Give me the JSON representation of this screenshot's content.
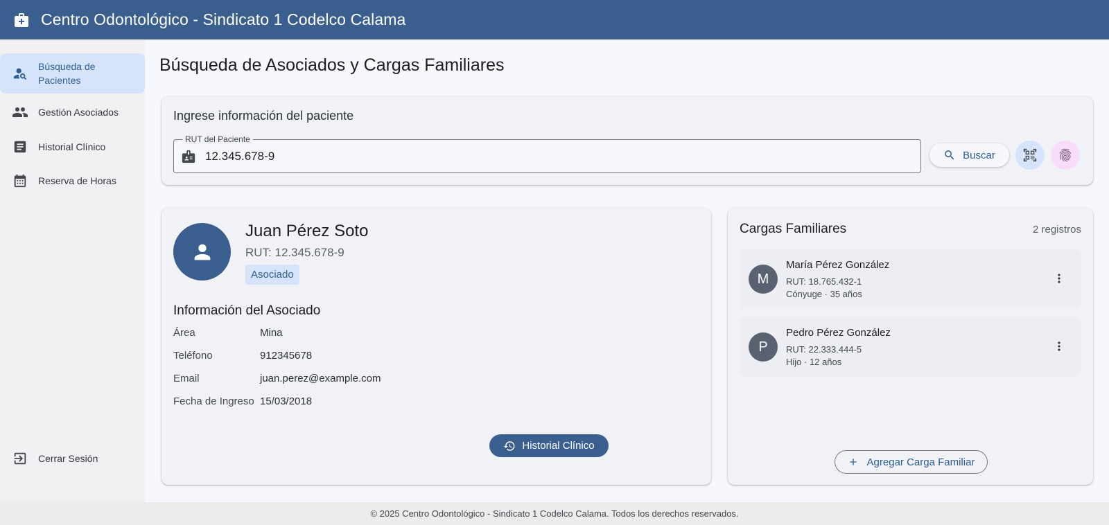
{
  "app": {
    "title": "Centro Odontológico - Sindicato 1 Codelco Calama",
    "logo_icon": "medical-kit-icon"
  },
  "sidebar": {
    "items": [
      {
        "label": "Búsqueda de Pacientes",
        "icon": "person-search-icon",
        "active": true
      },
      {
        "label": "Gestión Asociados",
        "icon": "group-icon",
        "active": false
      },
      {
        "label": "Historial Clínico",
        "icon": "document-icon",
        "active": false
      },
      {
        "label": "Reserva de Horas",
        "icon": "calendar-icon",
        "active": false
      }
    ],
    "logout_label": "Cerrar Sesión"
  },
  "main": {
    "title": "Búsqueda de Asociados y Cargas Familiares"
  },
  "search": {
    "heading": "Ingrese información del paciente",
    "field_label": "RUT del Paciente",
    "field_value": "12.345.678-9",
    "button_label": "Buscar"
  },
  "patient": {
    "name": "Juan Pérez Soto",
    "rut": "RUT: 12.345.678-9",
    "badge": "Asociado",
    "section_title": "Información del Asociado",
    "info": [
      {
        "key": "Área",
        "value": "Mina"
      },
      {
        "key": "Teléfono",
        "value": "912345678"
      },
      {
        "key": "Email",
        "value": "juan.perez@example.com"
      },
      {
        "key": "Fecha de Ingreso",
        "value": "15/03/2018"
      }
    ],
    "history_button": "Historial Clínico"
  },
  "family": {
    "title": "Cargas Familiares",
    "count": "2 registros",
    "members": [
      {
        "initial": "M",
        "name": "María Pérez González",
        "rut": "RUT: 18.765.432-1",
        "relation": "Cónyuge · 35 años"
      },
      {
        "initial": "P",
        "name": "Pedro Pérez González",
        "rut": "RUT: 22.333.444-5",
        "relation": "Hijo · 12 años"
      }
    ],
    "add_button": "Agregar Carga Familiar"
  },
  "footer": {
    "text": "© 2025 Centro Odontológico - Sindicato 1 Codelco Calama. Todos los derechos reservados."
  },
  "colors": {
    "primary": "#3a5f8f",
    "primary_container": "#d6e4fb",
    "tertiary_container": "#f8dcf8",
    "surface": "#f7f8fd",
    "sidebar": "#f1f1f3"
  }
}
